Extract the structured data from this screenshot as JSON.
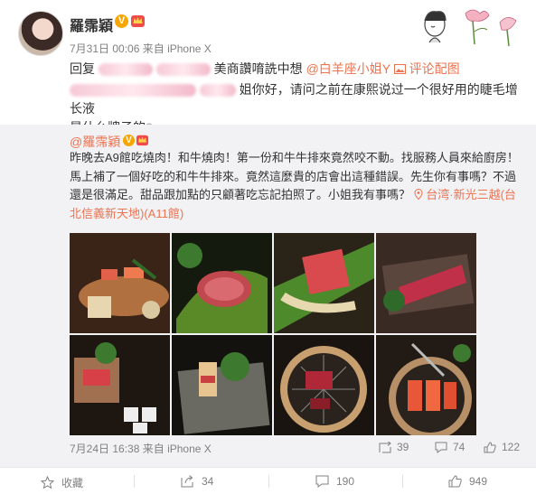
{
  "reply": {
    "username": "羅霈穎",
    "time": "7月31日 00:06",
    "source": "来自 iPhone X",
    "prefix": "回复",
    "mention_suffix": "美商讚唷詵中想",
    "mention_link": "@白羊座小姐Y",
    "comment_pic": "评论配图",
    "text_line2": "姐你好，请问之前在康熙说过一个很好用的睫毛增长液",
    "text_line3": "是什么牌子的",
    "emoji": "?"
  },
  "original": {
    "username": "@羅霈穎",
    "text": "昨晚去A9館吃燒肉！和牛燒肉！第一份和牛牛排來竟然咬不動。找服務人員來給廚房！馬上補了一個好吃的和牛牛排來。竟然這麼貴的店會出這種錯誤。先生你有事嗎？不過還是很滿足。甜品跟加點的只顧著吃忘記拍照了。小姐我有事嗎？",
    "location": "台湾·新光三越(台北信義新天地)(A11館)",
    "date": "7月24日 16:38",
    "source": "来自 iPhone X",
    "reposts": "39",
    "comments": "74",
    "likes": "122"
  },
  "photos": [
    {
      "name": "photo-sashimi-platter"
    },
    {
      "name": "photo-wagyu-leaf"
    },
    {
      "name": "photo-beef-on-leaf"
    },
    {
      "name": "photo-sliced-beef"
    },
    {
      "name": "photo-beef-display"
    },
    {
      "name": "photo-sandwich-plate"
    },
    {
      "name": "photo-grill-steak"
    },
    {
      "name": "photo-grill-slices"
    }
  ],
  "bottom_bar": {
    "favorite": "收藏",
    "repost": "34",
    "comment": "190",
    "like": "949"
  },
  "colors": {
    "accent": "#eb7350",
    "badge": "#f7a600",
    "muted": "#808080"
  }
}
